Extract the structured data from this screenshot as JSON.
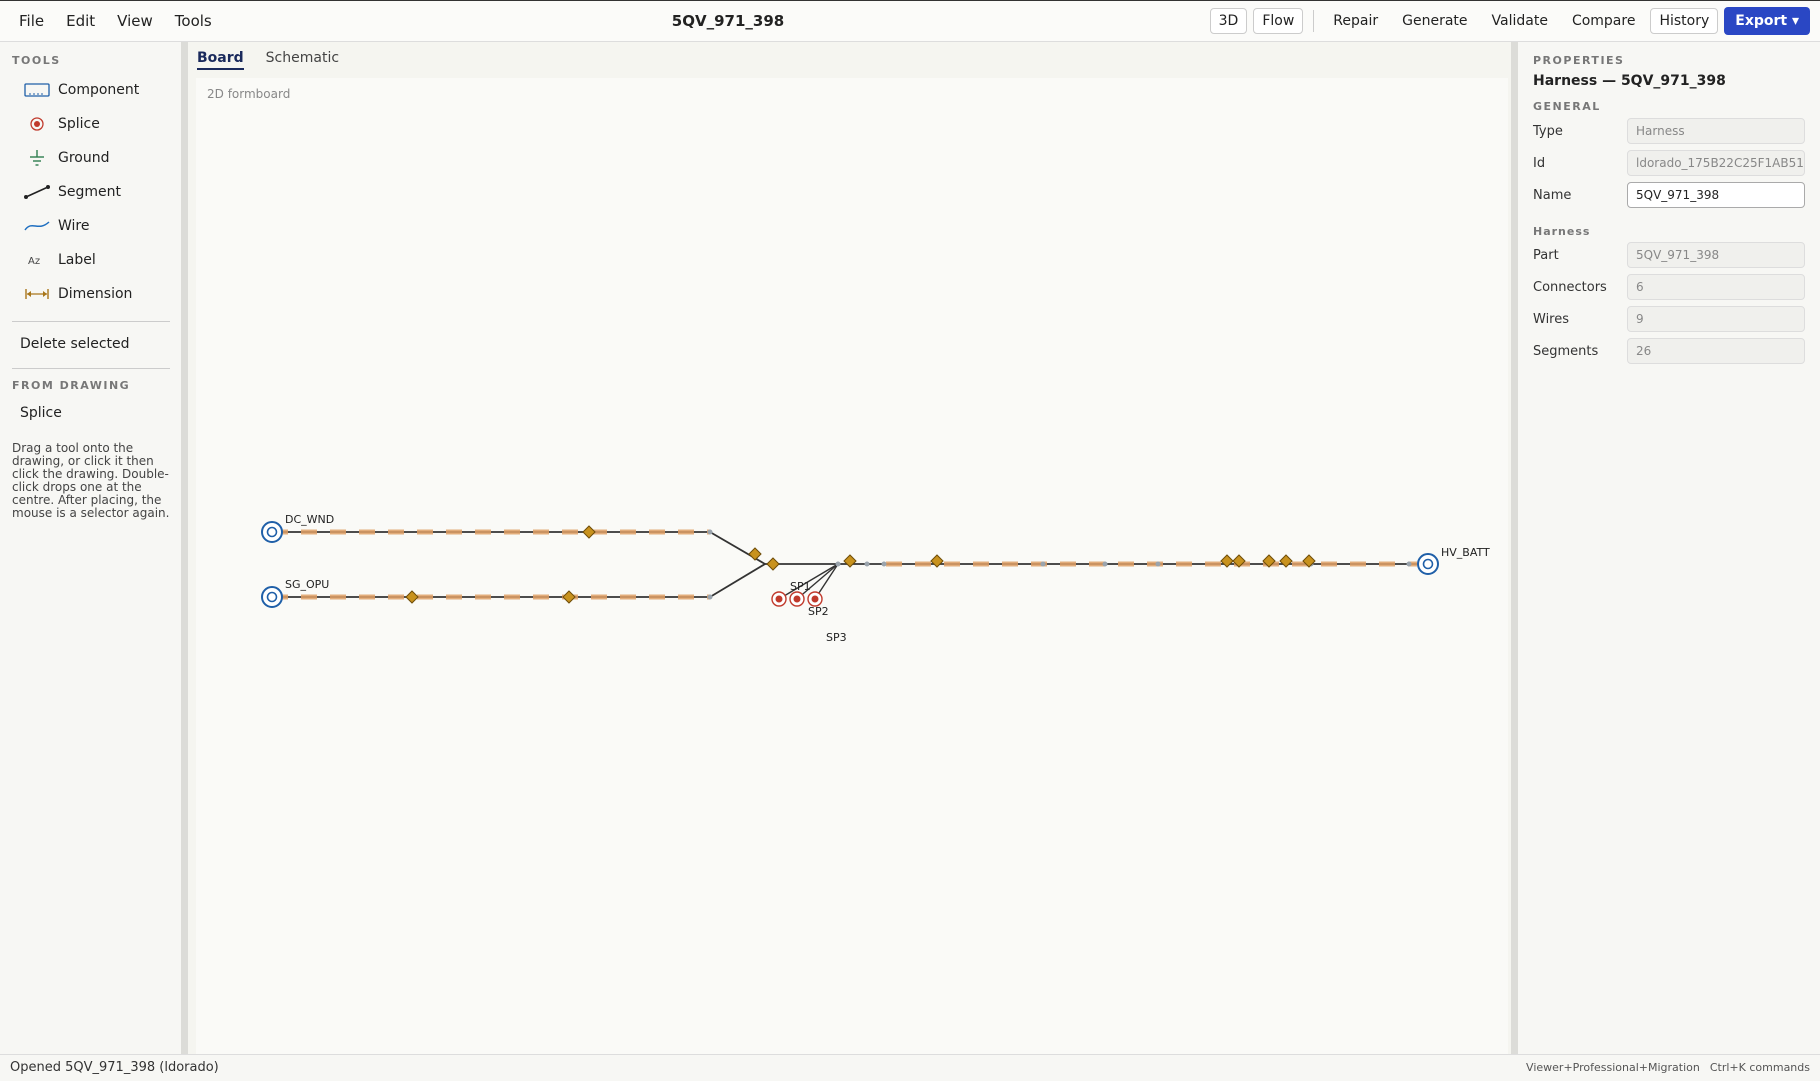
{
  "menu": {
    "file": "File",
    "edit": "Edit",
    "view": "View",
    "tools": "Tools"
  },
  "document": {
    "title": "5QV_971_398"
  },
  "toolbar": {
    "btn_3d": "3D",
    "btn_flow": "Flow",
    "repair": "Repair",
    "generate": "Generate",
    "validate": "Validate",
    "compare": "Compare",
    "history": "History",
    "export": "Export ▾"
  },
  "left": {
    "tools_heading": "TOOLS",
    "tools": [
      {
        "label": "Component",
        "icon": "component-icon"
      },
      {
        "label": "Splice",
        "icon": "splice-icon"
      },
      {
        "label": "Ground",
        "icon": "ground-icon"
      },
      {
        "label": "Segment",
        "icon": "segment-icon"
      },
      {
        "label": "Wire",
        "icon": "wire-icon"
      },
      {
        "label": "Label",
        "icon": "label-icon"
      },
      {
        "label": "Dimension",
        "icon": "dimension-icon"
      }
    ],
    "delete_selected": "Delete selected",
    "from_drawing_heading": "FROM DRAWING",
    "from_drawing_items": [
      "Splice"
    ],
    "hint_lines": [
      "Drag a tool onto the",
      "drawing, or click it then",
      "click the drawing. Double-",
      "click drops one at the",
      "centre. After placing, the",
      "mouse is a selector again."
    ]
  },
  "tabs": {
    "board": "Board",
    "schematic": "Schematic",
    "active": "Board"
  },
  "canvas": {
    "label": "2D formboard",
    "connectors": [
      "DC_WND",
      "SG_OPU",
      "HV_BATT"
    ],
    "splices": [
      "SP1",
      "SP2",
      "SP3"
    ]
  },
  "properties": {
    "heading": "PROPERTIES",
    "title": "Harness — 5QV_971_398",
    "general_heading": "GENERAL",
    "type_label": "Type",
    "type_value": "Harness",
    "id_label": "Id",
    "id_value": "ldorado_175B22C25F1AB51",
    "name_label": "Name",
    "name_value": "5QV_971_398",
    "harness_heading": "Harness",
    "part_label": "Part",
    "part_value": "5QV_971_398",
    "connectors_label": "Connectors",
    "connectors_value": "6",
    "wires_label": "Wires",
    "wires_value": "9",
    "segments_label": "Segments",
    "segments_value": "26"
  },
  "status": {
    "message": "Opened 5QV_971_398 (ldorado)",
    "license": "Viewer+Professional+Migration",
    "shortcut": "Ctrl+K commands"
  },
  "colors": {
    "accent": "#2a47c4",
    "connector": "#1f5fa8",
    "splice": "#c0392b",
    "segment_tape": "#e0a066",
    "fixture": "#c8921e"
  }
}
